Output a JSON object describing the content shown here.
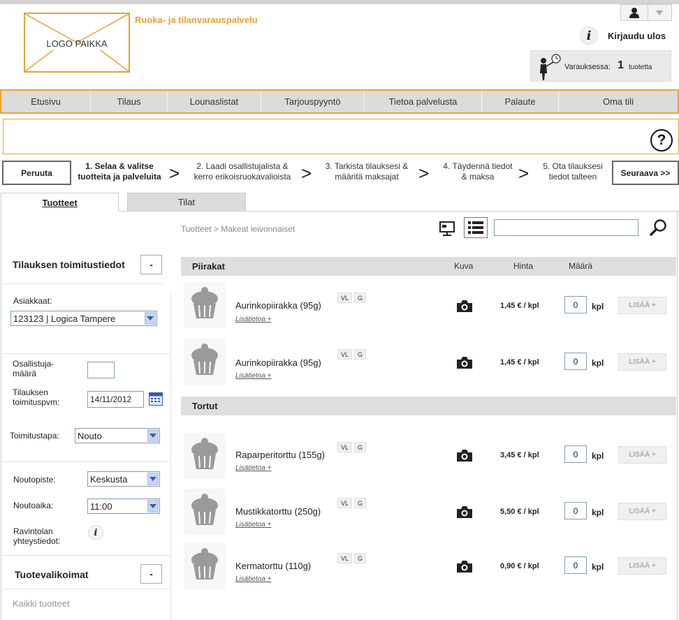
{
  "header": {
    "logo_text": "LOGO PAIKKA",
    "tagline": "Ruoka- ja tilanvarauspalvelu",
    "logout_label": "Kirjaudu ulos",
    "cart": {
      "label": "Varauksessa:",
      "count": "1",
      "unit": "tuotetta"
    }
  },
  "nav": {
    "items": [
      "Etusivu",
      "Tilaus",
      "Lounaslistat",
      "Tarjouspyyntö",
      "Tietoa palvelusta",
      "Palaute",
      "Oma tili"
    ]
  },
  "help_label": "?",
  "steps": {
    "cancel_label": "Peruuta",
    "next_label": "Seuraava >>",
    "arrow": ">",
    "items": [
      {
        "line1": "1. Selaa & valitse",
        "line2": "tuotteita ja palveluita",
        "active": true
      },
      {
        "line1": "2. Laadi osallistujalista &",
        "line2": "kerro erikoisruokavalioista",
        "active": false
      },
      {
        "line1": "3. Tarkista tilauksesi &",
        "line2": "määritä maksajat",
        "active": false
      },
      {
        "line1": "4. Täydennä  tiedot",
        "line2": "& maksa",
        "active": false
      },
      {
        "line1": "5. Ota tilauksesi",
        "line2": "tiedot talteen",
        "active": false
      }
    ]
  },
  "tabs": {
    "products": "Tuotteet",
    "spaces": "Tilat"
  },
  "sidebar": {
    "delivery_title": "Tilauksen toimitustiedot",
    "collapse_label": "-",
    "customer_label": "Asiakkaat:",
    "customer_value": "123123 | Logica Tampere",
    "participants_line1": "Osallistuja-",
    "participants_line2": "määrä",
    "participants_value": "",
    "date_line1": "Tilauksen",
    "date_line2": "toimituspvm:",
    "date_value": "14/11/2012",
    "delivery_method_label": "Toimitustapa:",
    "delivery_method_value": "Nouto",
    "pickup_point_label": "Noutopiste:",
    "pickup_point_value": "Keskusta",
    "pickup_time_label": "Noutoaika:",
    "pickup_time_value": "11:00",
    "restaurant_line1": "Ravintolan",
    "restaurant_line2": "yhteystiedot:",
    "selections_title": "Tuotevalikoimat",
    "all_products": "Kaikki tuotteet"
  },
  "main": {
    "breadcrumb": "Tuotteet > Makeat leivonnaiset",
    "search_value": "",
    "columns": {
      "image": "Kuva",
      "price": "Hinta",
      "quantity": "Määrä"
    },
    "categories": [
      {
        "title": "Piirakat",
        "products": [
          {
            "name": "Aurinkopiirakka (95g)",
            "more": "Lisätietoa +",
            "tags": [
              "VL",
              "G"
            ],
            "price": "1,45 € / kpl",
            "qty": "0",
            "unit": "kpl",
            "add": "LISÄÄ +"
          },
          {
            "name": "Aurinkopiirakka (95g)",
            "more": "Lisätietoa +",
            "tags": [
              "VL",
              "G"
            ],
            "price": "1,45 € / kpl",
            "qty": "0",
            "unit": "kpl",
            "add": "LISÄÄ +"
          }
        ]
      },
      {
        "title": "Tortut",
        "products": [
          {
            "name": "Raparperitorttu (155g)",
            "more": "Lisätietoa +",
            "tags": [
              "VL",
              "G"
            ],
            "price": "3,45 € / kpl",
            "qty": "0",
            "unit": "kpl",
            "add": "LISÄÄ +"
          },
          {
            "name": "Mustikkatorttu (250g)",
            "more": "Lisätietoa +",
            "tags": [
              "VL",
              "G"
            ],
            "price": "5,50 € / kpl",
            "qty": "0",
            "unit": "kpl",
            "add": "LISÄÄ +"
          },
          {
            "name": "Kermatorttu (110g)",
            "more": "Lisätietoa +",
            "tags": [
              "VL",
              "G"
            ],
            "price": "0,90 € / kpl",
            "qty": "0",
            "unit": "kpl",
            "add": "LISÄÄ +"
          }
        ]
      }
    ]
  },
  "colors": {
    "accent": "#e8a23a",
    "nav_bg": "#dcdcdc",
    "category_bar": "#dedede"
  },
  "icons": [
    "user-icon",
    "dropdown-arrow-icon",
    "info-icon",
    "cart-person-icon",
    "help-icon",
    "calendar-icon",
    "grid-view-icon",
    "list-view-icon",
    "search-icon",
    "cupcake-icon",
    "camera-icon"
  ]
}
